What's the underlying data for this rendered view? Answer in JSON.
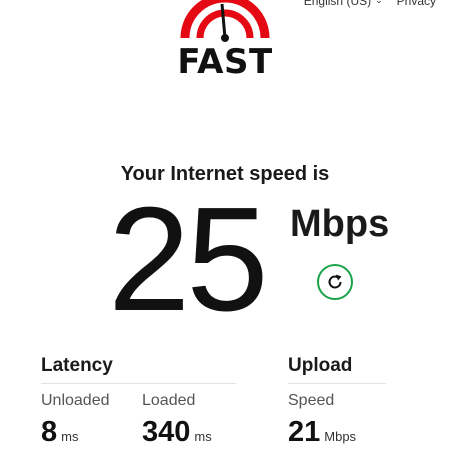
{
  "nav": {
    "language": "English (US)",
    "privacy": "Privacy"
  },
  "logo": {
    "text": "FAST",
    "icon": "speedometer-icon",
    "accent_color": "#e50914"
  },
  "speed": {
    "headline": "Your Internet speed is",
    "value": "25",
    "unit": "Mbps",
    "refresh_icon": "refresh-icon",
    "refresh_color": "#1aa34a"
  },
  "latency": {
    "title": "Latency",
    "unloaded": {
      "label": "Unloaded",
      "value": "8",
      "unit": "ms"
    },
    "loaded": {
      "label": "Loaded",
      "value": "340",
      "unit": "ms"
    }
  },
  "upload": {
    "title": "Upload",
    "speed": {
      "label": "Speed",
      "value": "21",
      "unit": "Mbps"
    }
  }
}
